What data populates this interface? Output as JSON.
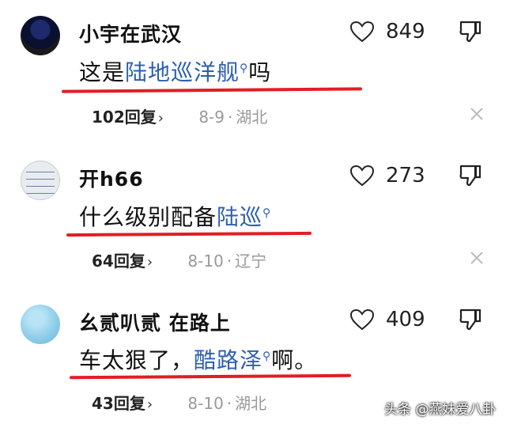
{
  "comments": [
    {
      "username": "小宇在武汉",
      "body_prefix": "这是",
      "body_link": "陆地巡洋舰",
      "body_suffix": "吗",
      "replies": "102回复",
      "date": "8-9",
      "location": "湖北",
      "likes": "849"
    },
    {
      "username": "开h66",
      "body_prefix": "什么级别配备",
      "body_link": "陆巡",
      "body_suffix": "",
      "replies": "64回复",
      "date": "8-10",
      "location": "辽宁",
      "likes": "273"
    },
    {
      "username": "幺贰叭贰 在路上",
      "body_prefix": "车太狠了，",
      "body_link": "酷路泽",
      "body_suffix": "啊。",
      "replies": "43回复",
      "date": "8-10",
      "location": "湖北",
      "likes": "409"
    }
  ],
  "watermark": "头条 @燕妹爱八卦",
  "colors": {
    "link": "#2c5fb0",
    "underline": "#e21d24",
    "meta": "#999999"
  },
  "icons": {
    "like": "heart-outline-icon",
    "dislike": "thumbs-down-icon",
    "close": "close-icon",
    "search": "search-icon"
  }
}
